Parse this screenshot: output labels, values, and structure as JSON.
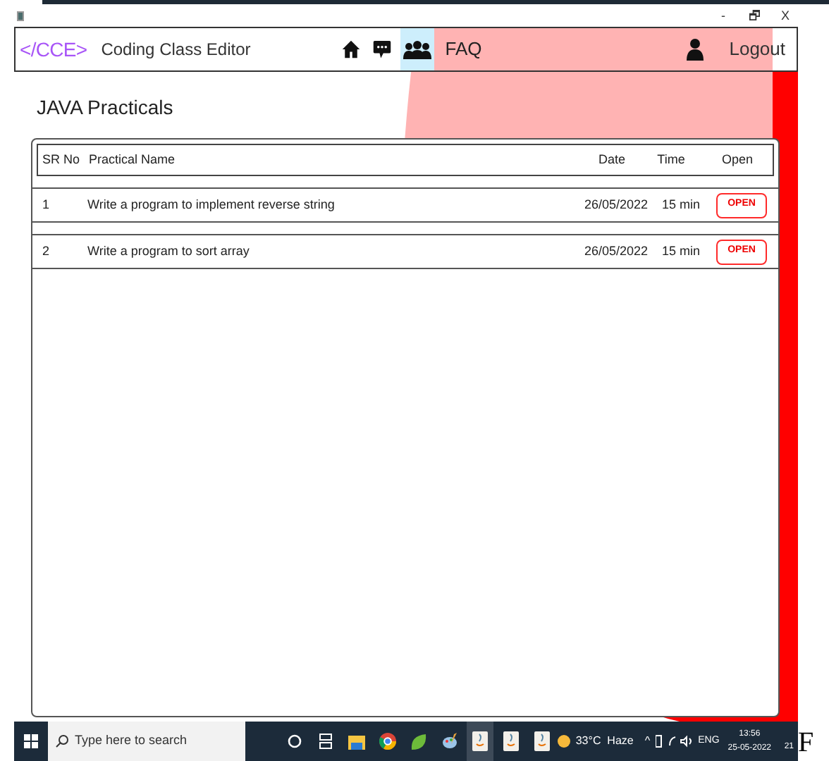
{
  "window": {
    "controls": [
      "-",
      "🗗",
      "X"
    ]
  },
  "navbar": {
    "logo": "</CCE>",
    "title": "Coding Class Editor",
    "items": [
      {
        "kind": "home",
        "selected": false
      },
      {
        "kind": "chat",
        "selected": false
      },
      {
        "kind": "group",
        "selected": true
      },
      {
        "kind": "text",
        "label": "FAQ",
        "selected": false
      }
    ],
    "logout": "Logout"
  },
  "page": {
    "heading": "JAVA Practicals"
  },
  "table": {
    "columns": [
      "SR No",
      "Practical Name",
      "Date",
      "Time",
      "Open"
    ],
    "rows": [
      {
        "sr": "1",
        "name": "Write a program to implement reverse string",
        "date": "26/05/2022",
        "time": "15 min",
        "action": "OPEN"
      },
      {
        "sr": "2",
        "name": "Write a program to sort array",
        "date": "26/05/2022",
        "time": "15 min",
        "action": "OPEN"
      }
    ]
  },
  "taskbar": {
    "search_placeholder": "Type here to search",
    "apps": [
      {
        "kind": "cortana",
        "active": false
      },
      {
        "kind": "taskview",
        "active": false
      },
      {
        "kind": "folder",
        "active": false
      },
      {
        "kind": "browser",
        "active": false
      },
      {
        "kind": "leaf",
        "active": false
      },
      {
        "kind": "paint",
        "active": false
      },
      {
        "kind": "java",
        "active": true
      },
      {
        "kind": "java",
        "active": false
      },
      {
        "kind": "java",
        "active": false
      }
    ],
    "weather": "33°C  Haze",
    "tray_caret": "^",
    "language": "ENG",
    "time": "13:56",
    "date": "25-05-2022",
    "notification_count": "21"
  },
  "stray_text": "F"
}
